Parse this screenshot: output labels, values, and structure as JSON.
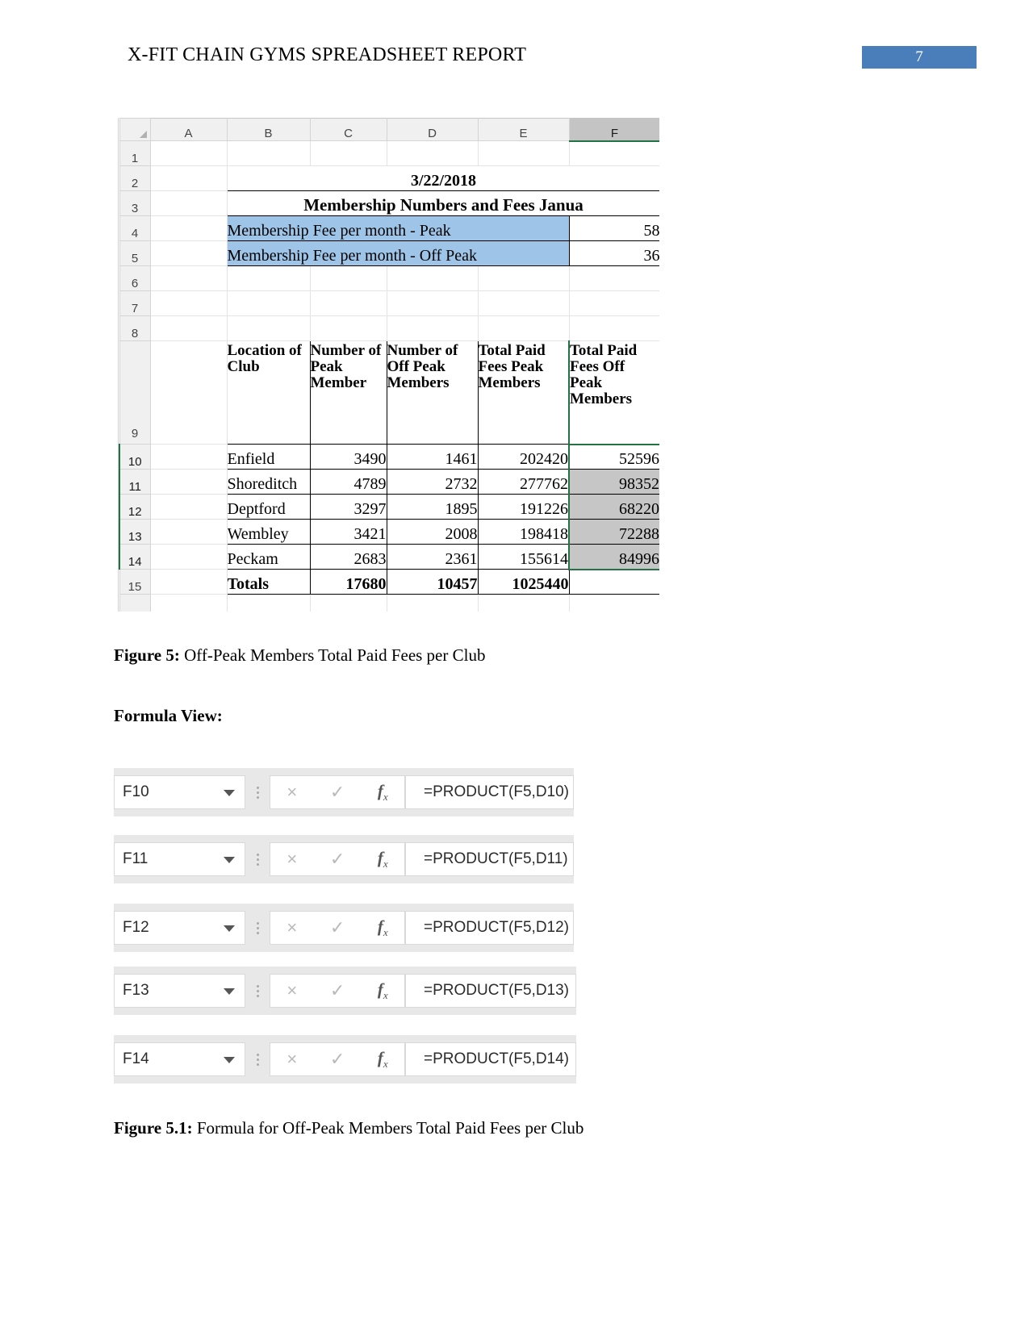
{
  "header": {
    "title": "X-FIT CHAIN GYMS SPREADSHEET REPORT",
    "page_number": "7",
    "page_number_bg": "#4a7ebb"
  },
  "spreadsheet": {
    "column_headers": [
      "A",
      "B",
      "C",
      "D",
      "E",
      "F"
    ],
    "selected_column": "F",
    "row_headers": [
      "1",
      "2",
      "3",
      "4",
      "5",
      "6",
      "7",
      "8",
      "9",
      "10",
      "11",
      "12",
      "13",
      "14",
      "15"
    ],
    "date_cell": "3/22/2018",
    "report_title_cell": "Membership Numbers and Fees Janua",
    "fee_peak_label": "Membership Fee per month - Peak",
    "fee_peak_value": "58",
    "fee_offpeak_label": "Membership Fee per month - Off Peak",
    "fee_offpeak_value": "36",
    "table_headers": [
      "Location of Club",
      "Number of Peak Member",
      "Number of Off Peak Members",
      "Total Paid Fees Peak Members",
      "Total Paid Fees Off Peak Members"
    ],
    "rows": [
      {
        "location": "Enfield",
        "peak": "3490",
        "offpeak": "1461",
        "fees_peak": "202420",
        "fees_offpeak": "52596"
      },
      {
        "location": "Shoreditch",
        "peak": "4789",
        "offpeak": "2732",
        "fees_peak": "277762",
        "fees_offpeak": "98352"
      },
      {
        "location": "Deptford",
        "peak": "3297",
        "offpeak": "1895",
        "fees_peak": "191226",
        "fees_offpeak": "68220"
      },
      {
        "location": "Wembley",
        "peak": "3421",
        "offpeak": "2008",
        "fees_peak": "198418",
        "fees_offpeak": "72288"
      },
      {
        "location": "Peckam",
        "peak": "2683",
        "offpeak": "2361",
        "fees_peak": "155614",
        "fees_offpeak": "84996"
      }
    ],
    "totals": {
      "label": "Totals",
      "peak": "17680",
      "offpeak": "10457",
      "fees_peak": "1025440",
      "fees_offpeak": ""
    },
    "highlight_fill": "#9ec5e8",
    "selection_fill": "#c6c6c6",
    "selection_border": "#217346"
  },
  "captions": {
    "figure5_label": "Figure 5:",
    "figure5_text": " Off-Peak Members Total Paid Fees per Club",
    "formula_view_heading": "Formula View:",
    "figure51_label": "Figure 5.1:",
    "figure51_text": " Formula for Off-Peak Members Total Paid Fees per Club"
  },
  "formula_bars": [
    {
      "name_box": "F10",
      "formula": "=PRODUCT(F5,D10)"
    },
    {
      "name_box": "F11",
      "formula": "=PRODUCT(F5,D11)"
    },
    {
      "name_box": "F12",
      "formula": "=PRODUCT(F5,D12)"
    },
    {
      "name_box": "F13",
      "formula": "=PRODUCT(F5,D13)"
    },
    {
      "name_box": "F14",
      "formula": "=PRODUCT(F5,D14)"
    }
  ],
  "formula_bar_icons": {
    "cancel": "×",
    "enter": "✓",
    "function": "fx"
  }
}
